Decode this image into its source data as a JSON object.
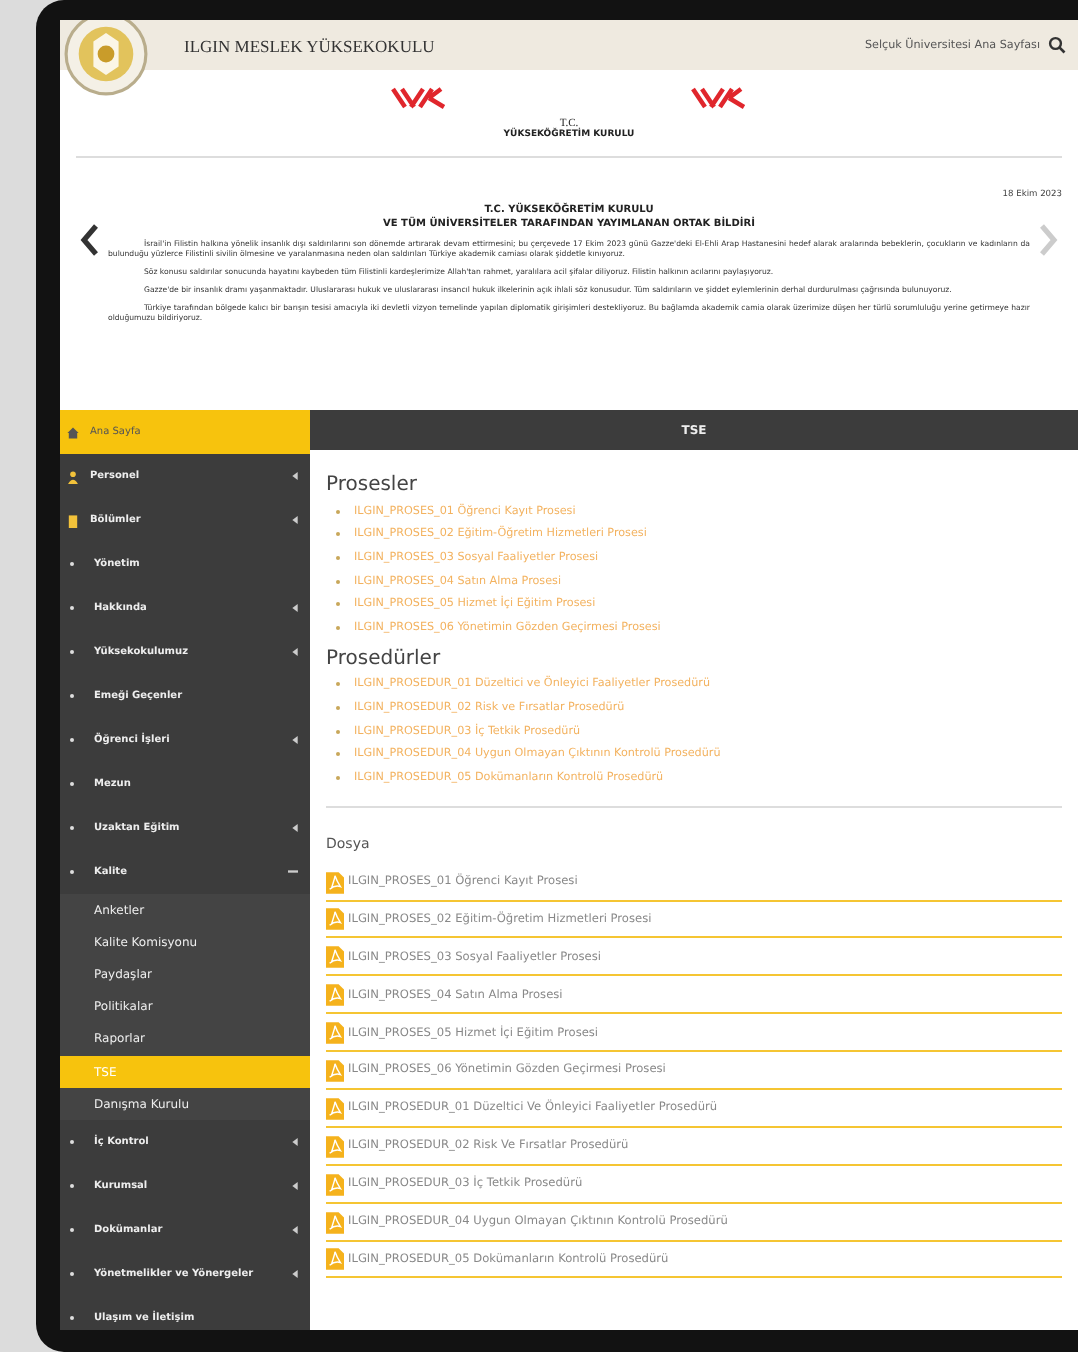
{
  "header": {
    "title": "ILGIN MESLEK YÜKSEKOKULU",
    "home_link": "Selçuk Üniversitesi Ana Sayfası"
  },
  "banner": {
    "caption_lines": [
      "T.C.",
      "YÜKSEKÖĞRETİM KURULU"
    ],
    "date": "18 Ekim 2023",
    "title_lines": [
      "T.C. YÜKSEKÖĞRETİM KURULU",
      "VE TÜM ÜNİVERSİTELER TARAFINDAN YAYIMLANAN ORTAK BİLDİRİ"
    ],
    "paragraphs": [
      "İsrail'in Filistin halkına yönelik insanlık dışı saldırılarını son dönemde artırarak devam ettirmesini; bu çerçevede 17 Ekim 2023 günü Gazze'deki El-Ehli Arap Hastanesini hedef alarak aralarında bebeklerin, çocukların ve kadınların da bulunduğu yüzlerce Filistinli sivilin ölmesine ve yaralanmasına neden olan saldırıları Türkiye akademik camiası olarak şiddetle kınıyoruz.",
      "Söz konusu saldırılar sonucunda hayatını kaybeden tüm Filistinli kardeşlerimize Allah'tan rahmet, yaralılara acil şifalar diliyoruz. Filistin halkının acılarını paylaşıyoruz.",
      "Gazze'de bir insanlık dramı yaşanmaktadır. Uluslararası hukuk ve uluslararası insancıl hukuk ilkelerinin açık ihlali söz konusudur. Tüm saldırıların ve şiddet eylemlerinin derhal durdurulması çağrısında bulunuyoruz.",
      "Türkiye tarafından bölgede kalıcı bir barışın tesisi amacıyla iki devletli vizyon temelinde yapılan diplomatik girişimleri destekliyoruz. Bu bağlamda akademik camia olarak üzerimize düşen her türlü sorumluluğu yerine getirmeye hazır olduğumuzu bildiriyoruz."
    ]
  },
  "sidebar": {
    "items": [
      {
        "label": "Ana Sayfa",
        "kind": "home",
        "has_submenu": false,
        "selected": true
      },
      {
        "label": "Personel",
        "kind": "person",
        "has_submenu": true,
        "expanded": false,
        "selected": false
      },
      {
        "label": "Bölümler",
        "kind": "building",
        "has_submenu": true,
        "expanded": false,
        "selected": false
      },
      {
        "label": "Yönetim",
        "kind": "bullet",
        "has_submenu": false,
        "selected": false
      },
      {
        "label": "Hakkında",
        "kind": "bullet",
        "has_submenu": true,
        "expanded": false,
        "selected": false
      },
      {
        "label": "Yüksekokulumuz",
        "kind": "bullet",
        "has_submenu": true,
        "expanded": false,
        "selected": false
      },
      {
        "label": "Emeği Geçenler",
        "kind": "bullet",
        "has_submenu": false,
        "selected": false
      },
      {
        "label": "Öğrenci İşleri",
        "kind": "bullet",
        "has_submenu": true,
        "expanded": false,
        "selected": false
      },
      {
        "label": "Mezun",
        "kind": "bullet",
        "has_submenu": false,
        "selected": false
      },
      {
        "label": "Uzaktan Eğitim",
        "kind": "bullet",
        "has_submenu": true,
        "expanded": false,
        "selected": false
      },
      {
        "label": "Kalite",
        "kind": "bullet",
        "has_submenu": true,
        "expanded": true,
        "selected": false,
        "children": [
          {
            "label": "Anketler",
            "selected": false
          },
          {
            "label": "Kalite Komisyonu",
            "selected": false
          },
          {
            "label": "Paydaşlar",
            "selected": false
          },
          {
            "label": "Politikalar",
            "selected": false
          },
          {
            "label": "Raporlar",
            "selected": false
          },
          {
            "label": "TSE",
            "selected": true
          },
          {
            "label": "Danışma Kurulu",
            "selected": false
          }
        ]
      },
      {
        "label": "İç Kontrol",
        "kind": "bullet",
        "has_submenu": true,
        "expanded": false,
        "selected": false
      },
      {
        "label": "Kurumsal",
        "kind": "bullet",
        "has_submenu": true,
        "expanded": false,
        "selected": false
      },
      {
        "label": "Dokümanlar",
        "kind": "bullet",
        "has_submenu": true,
        "expanded": false,
        "selected": false
      },
      {
        "label": "Yönetmelikler ve Yönergeler",
        "kind": "bullet",
        "has_submenu": true,
        "expanded": false,
        "selected": false
      },
      {
        "label": "Ulaşım ve İletişim",
        "kind": "bullet",
        "has_submenu": false,
        "selected": false
      }
    ]
  },
  "main": {
    "title": "TSE",
    "sections": [
      {
        "heading": "Prosesler",
        "links": [
          "ILGIN_PROSES_01 Öğrenci Kayıt Prosesi",
          "ILGIN_PROSES_02 Eğitim-Öğretim Hizmetleri Prosesi",
          "ILGIN_PROSES_03 Sosyal Faaliyetler Prosesi",
          "ILGIN_PROSES_04 Satın Alma Prosesi",
          "ILGIN_PROSES_05 Hizmet İçi Eğitim Prosesi",
          "ILGIN_PROSES_06 Yönetimin Gözden Geçirmesi Prosesi"
        ]
      },
      {
        "heading": "Prosedürler",
        "links": [
          "ILGIN_PROSEDUR_01 Düzeltici ve Önleyici Faaliyetler Prosedürü",
          "ILGIN_PROSEDUR_02 Risk ve Fırsatlar Prosedürü",
          "ILGIN_PROSEDUR_03 İç Tetkik Prosedürü",
          "ILGIN_PROSEDUR_04 Uygun Olmayan Çıktının Kontrolü Prosedürü",
          "ILGIN_PROSEDUR_05 Dokümanların Kontrolü Prosedürü"
        ]
      }
    ],
    "files": {
      "heading": "Dosya",
      "items": [
        "ILGIN_PROSES_01 Öğrenci Kayıt Prosesi",
        "ILGIN_PROSES_02 Eğitim-Öğretim Hizmetleri Prosesi",
        "ILGIN_PROSES_03 Sosyal Faaliyetler Prosesi",
        "ILGIN_PROSES_04 Satın Alma Prosesi",
        "ILGIN_PROSES_05 Hizmet İçi Eğitim Prosesi",
        "ILGIN_PROSES_06 Yönetimin Gözden Geçirmesi Prosesi",
        "ILGIN_PROSEDUR_01 Düzeltici Ve Önleyici Faaliyetler Prosedürü",
        "ILGIN_PROSEDUR_02 Risk Ve Fırsatlar Prosedürü",
        "ILGIN_PROSEDUR_03 İç Tetkik Prosedürü",
        "ILGIN_PROSEDUR_04 Uygun Olmayan Çıktının Kontrolü Prosedürü",
        "ILGIN_PROSEDUR_05 Dokümanların Kontrolü Prosedürü"
      ]
    }
  }
}
